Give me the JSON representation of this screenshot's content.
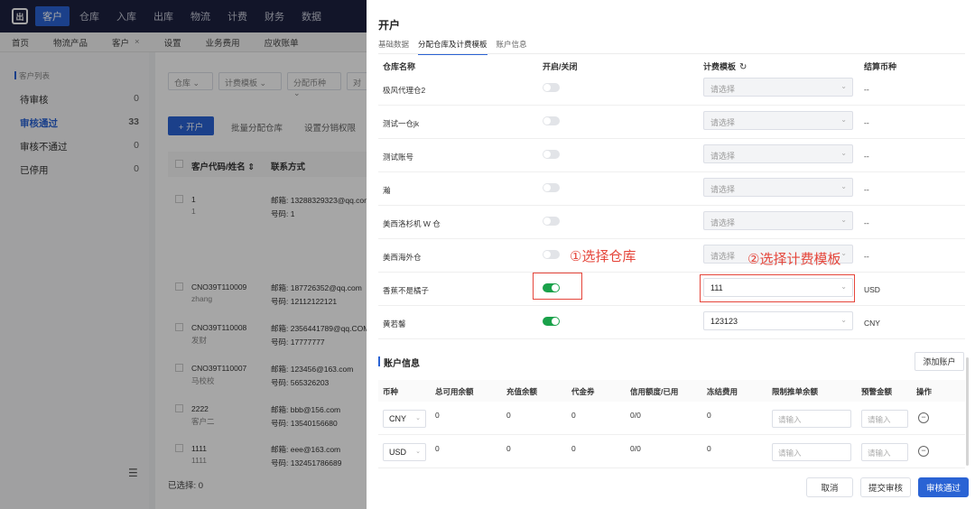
{
  "topnav": {
    "logo": "出",
    "items": [
      "客户",
      "仓库",
      "入库",
      "出库",
      "物流",
      "计费",
      "财务",
      "数据"
    ],
    "active_index": 0
  },
  "tabs": [
    "首页",
    "物流产品",
    "客户",
    "×",
    "设置",
    "业务费用",
    "应收账单"
  ],
  "sidebar": {
    "heading": "客户列表",
    "items": [
      {
        "label": "待审核",
        "count": "0"
      },
      {
        "label": "审核通过",
        "count": "33",
        "active": true
      },
      {
        "label": "审核不通过",
        "count": "0"
      },
      {
        "label": "已停用",
        "count": "0"
      }
    ]
  },
  "main": {
    "filters": [
      "仓库 ⌄",
      "计费模板 ⌄",
      "分配币种 ⌄",
      "对"
    ],
    "open_button": "+ 开户",
    "batch_assign": "批量分配仓库",
    "set_permission": "设置分销权限",
    "columns": [
      "客户代码/姓名 ⇕",
      "联系方式"
    ],
    "rows": [
      {
        "code": "1",
        "name": "1",
        "email": "邮箱:  13288329323@qq.com",
        "phone": "号码:  1"
      },
      {
        "code": "CNO39T110009",
        "name": "zhang",
        "email": "邮箱:  187726352@qq.com",
        "phone": "号码:  12112122121"
      },
      {
        "code": "CNO39T110008",
        "name": "发财",
        "email": "邮箱:  2356441789@qq.COM",
        "phone": "号码:  17777777"
      },
      {
        "code": "CNO39T110007",
        "name": "马校校",
        "email": "邮箱:  123456@163.com",
        "phone": "号码:  565326203"
      },
      {
        "code": "2222",
        "name": "客户二",
        "email": "邮箱:  bbb@156.com",
        "phone": "号码:  13540156680"
      },
      {
        "code": "1111",
        "name": "1111",
        "email": "邮箱:  eee@163.com",
        "phone": "号码:  132451786689"
      }
    ],
    "selected_text": "已选择: 0"
  },
  "drawer": {
    "title": "开户",
    "tabs": [
      "基础数据",
      "分配仓库及计费模板",
      "账户信息"
    ],
    "active_tab": 1,
    "warehouse_columns": {
      "name": "仓库名称",
      "toggle": "开启/关闭",
      "template": "计费模板",
      "currency": "结算币种"
    },
    "refresh_icon": "↻",
    "warehouses": [
      {
        "name": "极风代理仓2",
        "on": false,
        "template": "请选择",
        "currency": "--"
      },
      {
        "name": "测试一仓jk",
        "on": false,
        "template": "请选择",
        "currency": "--"
      },
      {
        "name": "测试账号",
        "on": false,
        "template": "请选择",
        "currency": "--"
      },
      {
        "name": "瀚",
        "on": false,
        "template": "请选择",
        "currency": "--"
      },
      {
        "name": "美西洛杉机 W 仓",
        "on": false,
        "template": "请选择",
        "currency": "--"
      },
      {
        "name": "美西海外仓",
        "on": false,
        "template": "请选择",
        "currency": "--"
      },
      {
        "name": "香蕉不是橘子",
        "on": true,
        "template": "111",
        "currency": "USD"
      },
      {
        "name": "黄若馨",
        "on": true,
        "template": "123123",
        "currency": "CNY"
      }
    ],
    "annotation_1": "①选择仓库",
    "annotation_2": "②选择计费模板",
    "account_title": "账户信息",
    "add_account": "添加账户",
    "account_columns": [
      "币种",
      "总可用余额",
      "充值余额",
      "代金券",
      "信用额度/已用",
      "冻结费用",
      "限制推单余额",
      "预警金额",
      "操作"
    ],
    "accounts": [
      {
        "currency": "CNY",
        "total": "0",
        "recharge": "0",
        "voucher": "0",
        "credit": "0/0",
        "frozen": "0",
        "limit_ph": "请输入",
        "warn_ph": "请输入"
      },
      {
        "currency": "USD",
        "total": "0",
        "recharge": "0",
        "voucher": "0",
        "credit": "0/0",
        "frozen": "0",
        "limit_ph": "请输入",
        "warn_ph": "请输入"
      }
    ],
    "buttons": {
      "cancel": "取消",
      "submit": "提交审核",
      "approve": "审核通过"
    }
  }
}
